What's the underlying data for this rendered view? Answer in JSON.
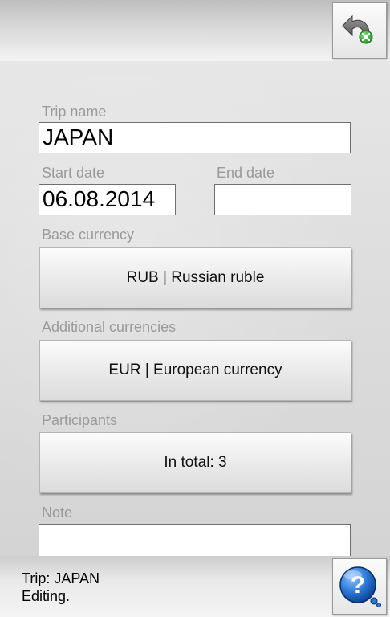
{
  "header": {
    "undo_icon": "undo-with-green-x-icon"
  },
  "form": {
    "trip_name_label": "Trip name",
    "trip_name_value": "JAPAN",
    "start_date_label": "Start date",
    "start_date_value": "06.08.2014",
    "end_date_label": "End date",
    "end_date_value": "",
    "base_currency_label": "Base currency",
    "base_currency_value": "RUB | Russian ruble",
    "additional_currencies_label": "Additional currencies",
    "additional_currencies_value": "EUR | European currency",
    "participants_label": "Participants",
    "participants_value": "In total: 3",
    "note_label": "Note",
    "note_value": ""
  },
  "footer": {
    "status_line1": "Trip: JAPAN",
    "status_line2": "Editing.",
    "help_icon": "help-question-icon"
  },
  "colors": {
    "label_gray": "#9a9a9a",
    "help_blue": "#1f6fd1",
    "undo_green": "#2fae2f"
  }
}
